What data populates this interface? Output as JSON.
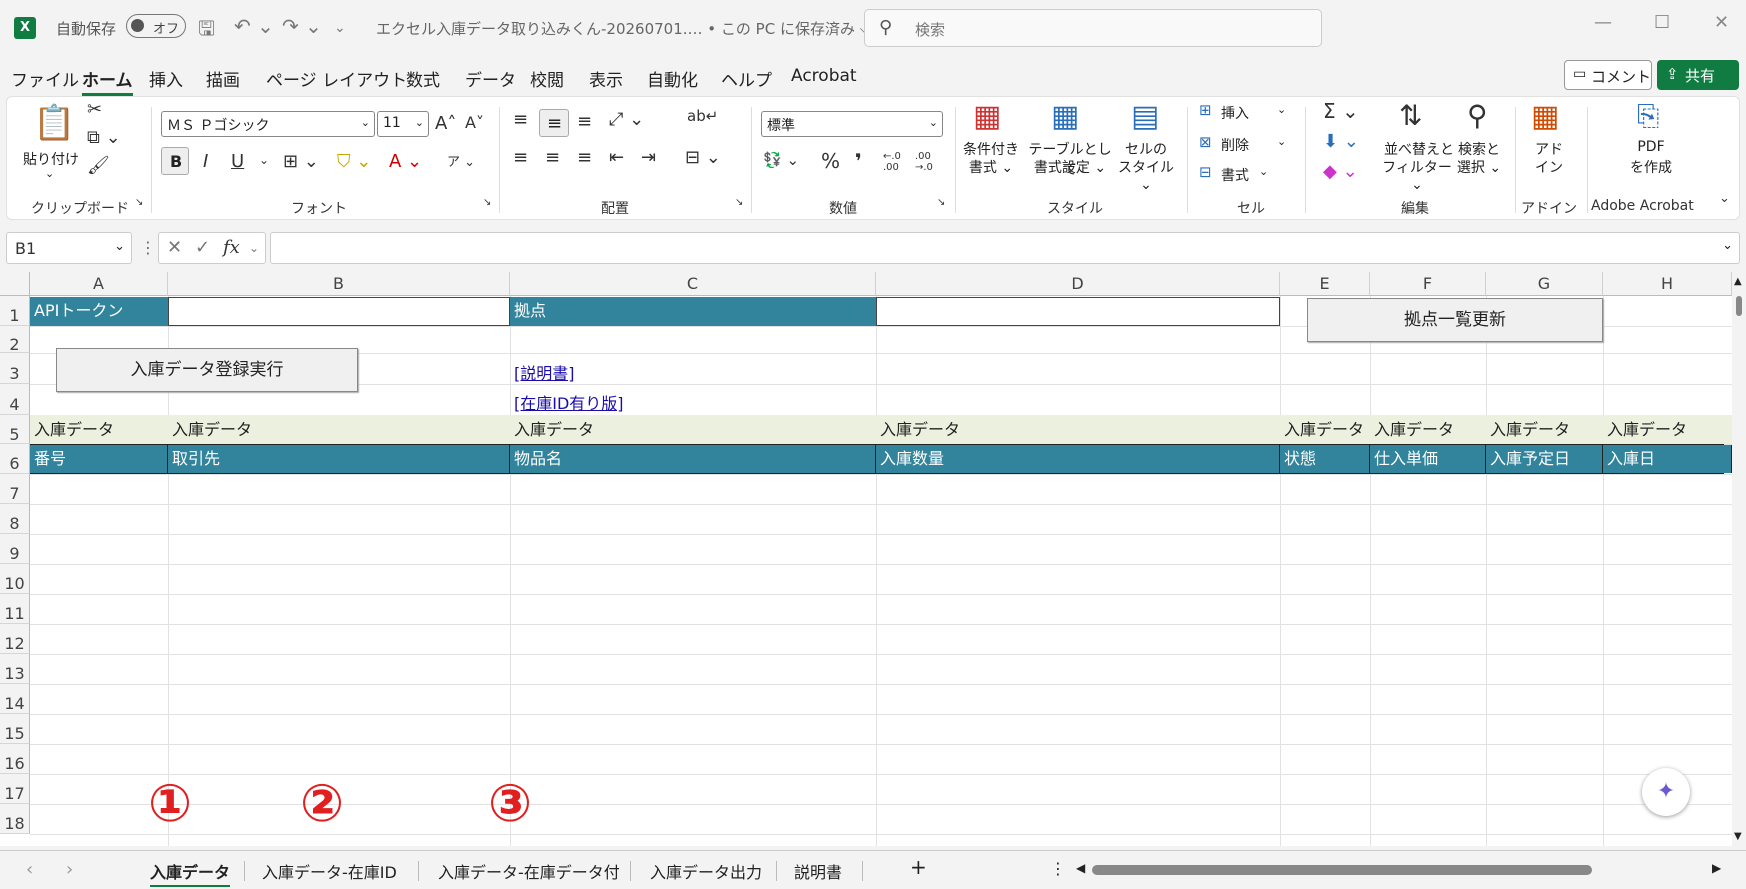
{
  "titlebar": {
    "app_icon": "X",
    "autosave_label": "自動保存",
    "autosave_state": "オフ",
    "filename": "エクセル入庫データ取り込みくん-20260701.… • この PC に保存済み ⌵",
    "search_placeholder": "検索"
  },
  "menu": {
    "items": [
      "ファイル",
      "ホーム",
      "挿入",
      "描画",
      "ページ レイアウト",
      "数式",
      "データ",
      "校閲",
      "表示",
      "自動化",
      "ヘルプ",
      "Acrobat"
    ],
    "comment_label": "コメント",
    "share_label": "共有"
  },
  "ribbon": {
    "clipboard": {
      "paste_label": "貼り付け",
      "group_label": "クリップボード"
    },
    "font": {
      "font_name": "ＭＳ Ｐゴシック",
      "font_size": "11",
      "bold": "B",
      "italic": "I",
      "underline": "U",
      "group_label": "フォント"
    },
    "alignment": {
      "group_label": "配置"
    },
    "number": {
      "format": "標準",
      "percent": "%",
      "comma": "❜",
      "inc": "←.0 .00",
      "dec": ".00 →.0",
      "group_label": "数値"
    },
    "styles": {
      "conditional_line1": "条件付き",
      "conditional_line2": "書式 ⌄",
      "table_line1": "テーブルとして",
      "table_line2": "書式設定 ⌄",
      "cell_line1": "セルの",
      "cell_line2": "スタイル ⌄",
      "group_label": "スタイル"
    },
    "cells": {
      "insert": "挿入",
      "delete": "削除",
      "format": "書式",
      "group_label": "セル"
    },
    "editing": {
      "sort_line1": "並べ替えと",
      "sort_line2": "フィルター ⌄",
      "find_line1": "検索と",
      "find_line2": "選択 ⌄",
      "group_label": "編集"
    },
    "addin": {
      "line1": "アド",
      "line2": "イン",
      "group_label": "アドイン"
    },
    "acrobat": {
      "line1": "PDF",
      "line2": "を作成",
      "group_label": "Adobe Acrobat"
    }
  },
  "formula_bar": {
    "name_box": "B1",
    "fx": "fx",
    "formula": ""
  },
  "columns": [
    "A",
    "B",
    "C",
    "D",
    "E",
    "F",
    "G",
    "H"
  ],
  "rows": [
    "1",
    "2",
    "3",
    "4",
    "5",
    "6",
    "7",
    "8",
    "9",
    "10",
    "11",
    "12",
    "13",
    "14",
    "15",
    "16",
    "17",
    "18"
  ],
  "sheet": {
    "a1": "APIトークン",
    "c1": "拠点",
    "button_refresh": "拠点一覧更新",
    "button_register": "入庫データ登録実行",
    "link_manual": "[説明書]",
    "link_stock_id": "[在庫ID有り版]",
    "row5": [
      "入庫データ",
      "入庫データ",
      "入庫データ",
      "入庫データ",
      "入庫データ",
      "入庫データ",
      "入庫データ",
      "入庫データ"
    ],
    "row6": [
      "番号",
      "取引先",
      "物品名",
      "入庫数量",
      "状態",
      "仕入単価",
      "入庫予定日",
      "入庫日"
    ]
  },
  "annotations": [
    "①",
    "②",
    "③"
  ],
  "tabs": [
    "入庫データ",
    "入庫データ-在庫ID",
    "入庫データ-在庫データ付",
    "入庫データ出力",
    "説明書"
  ],
  "tab_add": "+",
  "colors": {
    "teal": "#31849b",
    "band": "#ebf1de",
    "excel_green": "#107c41",
    "annotation_red": "#e02020"
  }
}
